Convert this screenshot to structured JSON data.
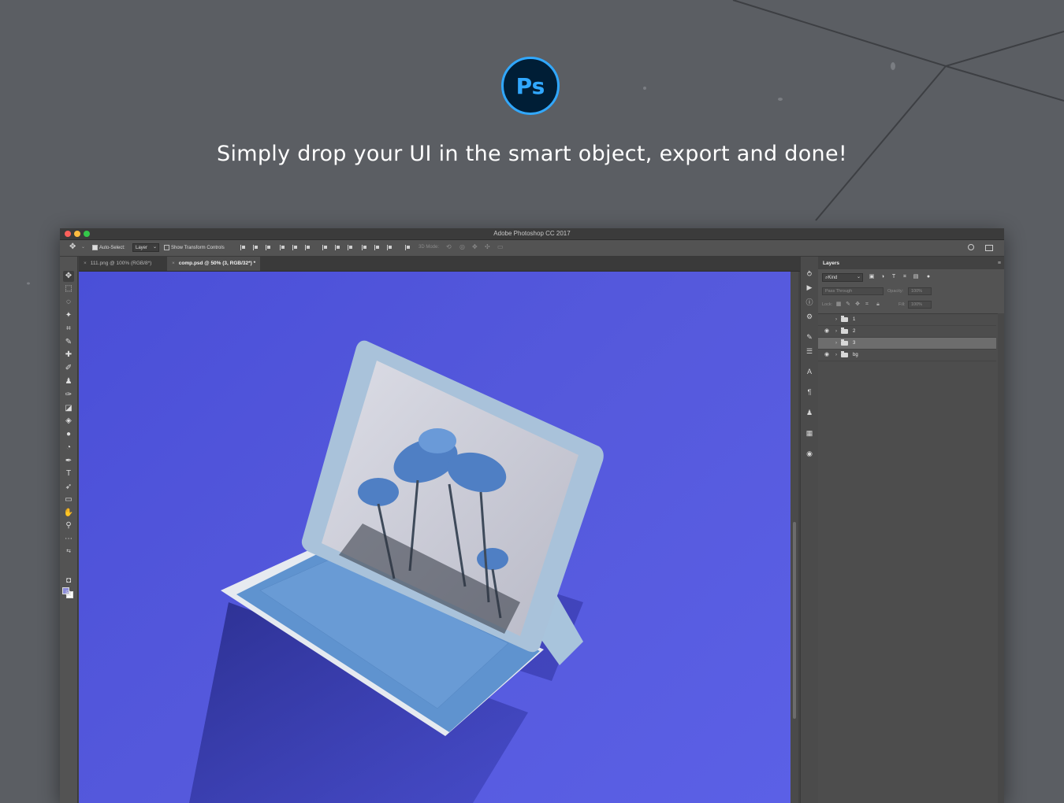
{
  "hero": {
    "logo_text": "Ps",
    "headline": "Simply drop your UI in the smart object, export and done!"
  },
  "window": {
    "title": "Adobe Photoshop CC 2017"
  },
  "options_bar": {
    "auto_select_label": "Auto-Select:",
    "auto_select_checked": true,
    "auto_select_target": "Layer",
    "show_transform_label": "Show Transform Controls",
    "show_transform_checked": false,
    "mode_3d_label": "3D Mode:"
  },
  "tabs": [
    {
      "label": "111.png @ 100% (RGB/8*)",
      "active": false
    },
    {
      "label": "comp.psd @ 50% (3, RGB/32*) *",
      "active": true
    }
  ],
  "colors": {
    "foreground": "#8b8bd8",
    "background": "#ffffff",
    "canvas": "#5559dc",
    "accent": "#31a8ff"
  },
  "layers_panel": {
    "title": "Layers",
    "filter_kind": "Kind",
    "blend_mode": "Pass Through",
    "opacity_label": "Opacity:",
    "opacity_value": "100%",
    "lock_label": "Lock:",
    "fill_label": "Fill:",
    "fill_value": "100%",
    "layers": [
      {
        "name": "1",
        "visible": false,
        "selected": false
      },
      {
        "name": "2",
        "visible": true,
        "selected": false
      },
      {
        "name": "3",
        "visible": false,
        "selected": true
      },
      {
        "name": "bg",
        "visible": true,
        "selected": false
      }
    ]
  }
}
